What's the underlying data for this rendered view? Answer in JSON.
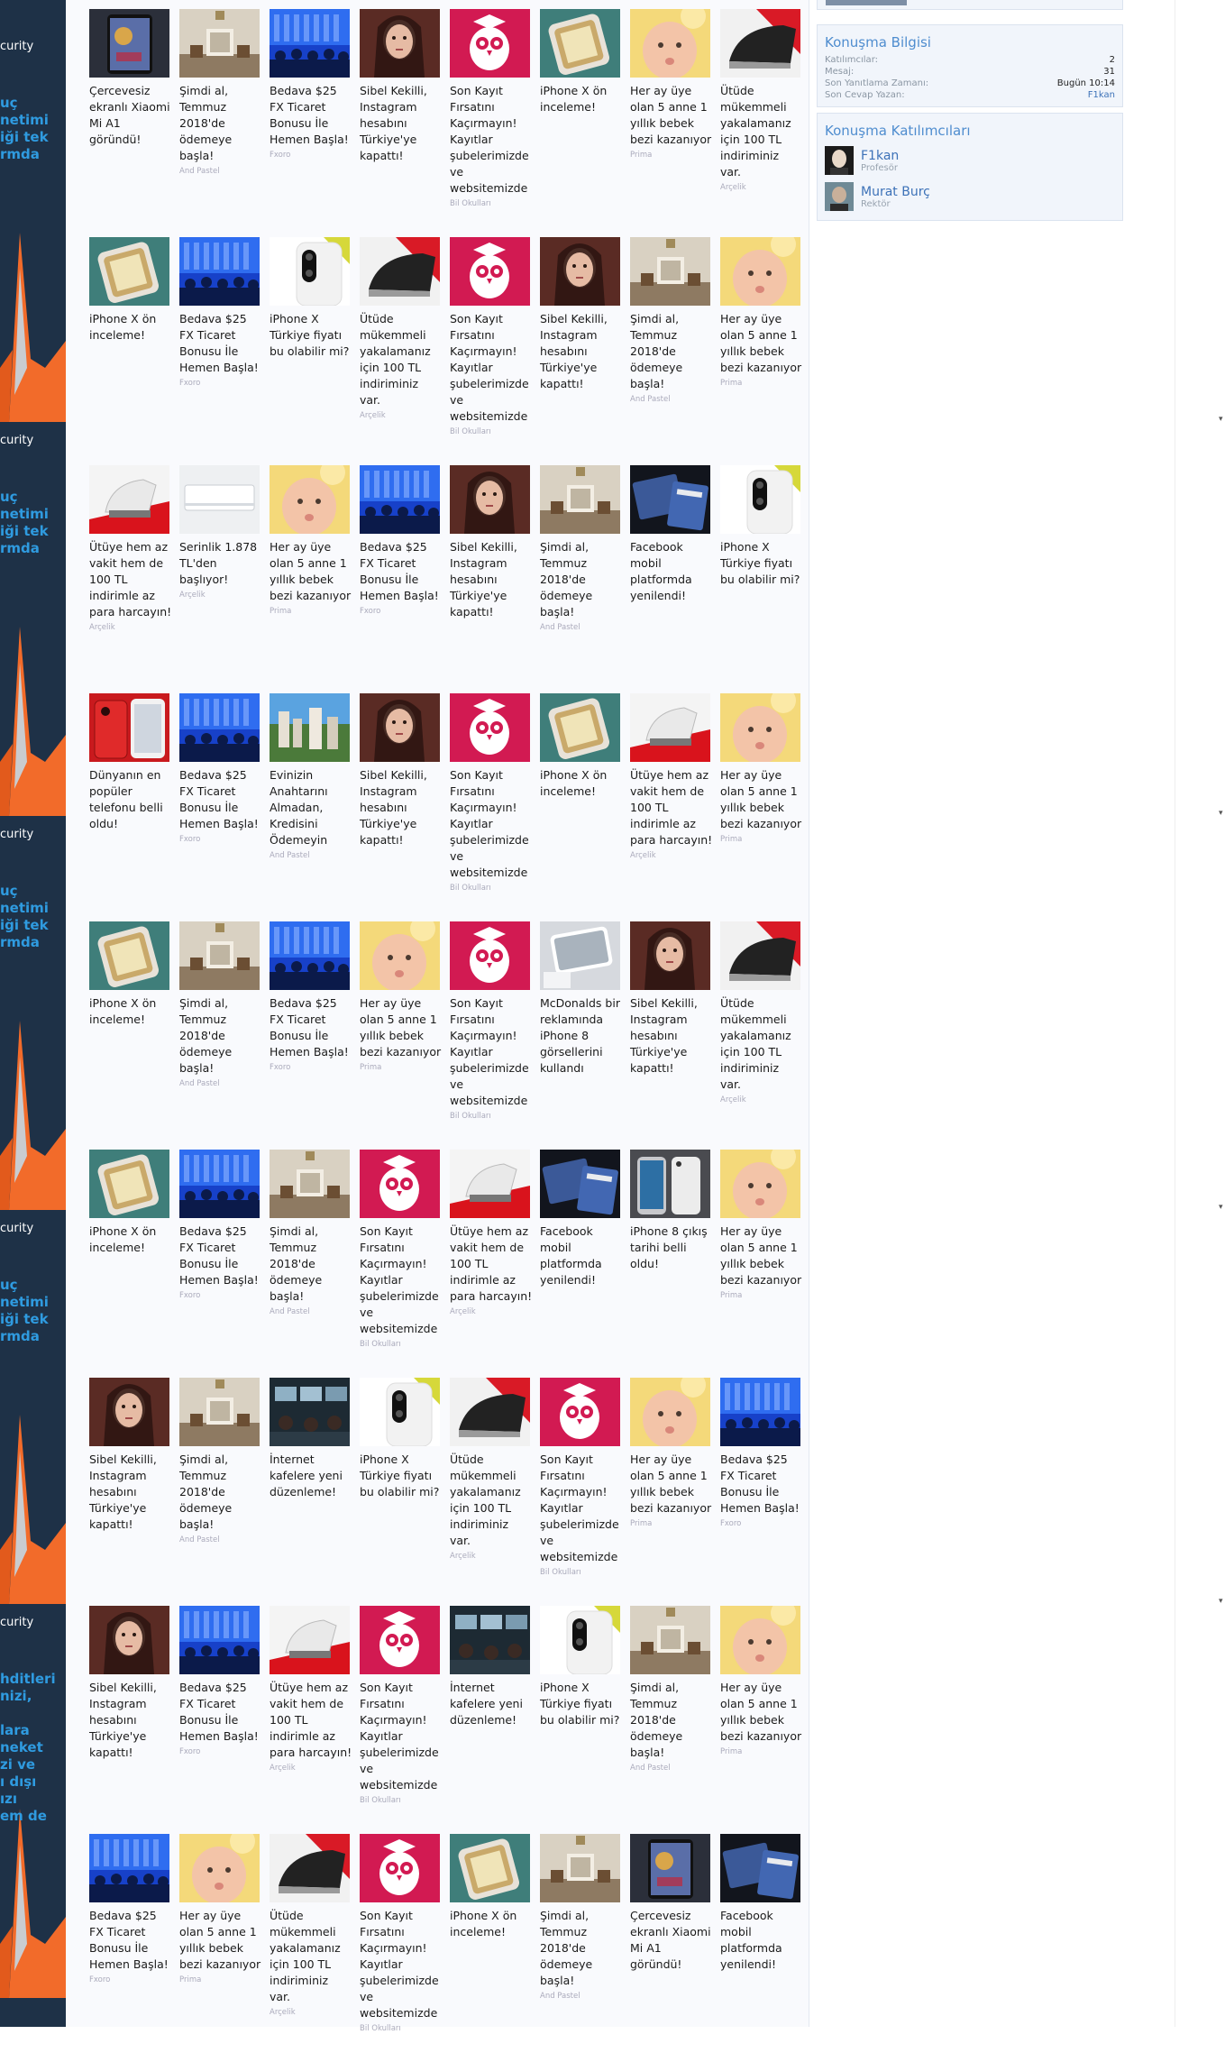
{
  "left_ad": {
    "word": "curity",
    "lines_a": "uç\nnetimi\niği tek\nrmda",
    "lines_b": "hditleri\nnizi,\n\nlara\nneket\nzi ve\nı dışı\nızı\nem de"
  },
  "ads": [
    {
      "title": "Çercevesiz ekranlı Xiaomi Mi A1 göründü!",
      "source": "",
      "img": "phone-dark"
    },
    {
      "title": "Şimdi al, Temmuz 2018'de ödemeye başla!",
      "source": "And Pastel",
      "img": "room"
    },
    {
      "title": "Bedava $25 FX Ticaret Bonusu İle Hemen Başla!",
      "source": "Fxoro",
      "img": "crowd"
    },
    {
      "title": "Sibel Kekilli, Instagram hesabını Türkiye'ye kapattı!",
      "source": "",
      "img": "woman"
    },
    {
      "title": "Son Kayıt Fırsatını Kaçırmayın! Kayıtlar şubelerimizde ve websitemizde",
      "source": "Bil Okulları",
      "img": "owl"
    },
    {
      "title": "iPhone X ön inceleme!",
      "source": "",
      "img": "iphone-green"
    },
    {
      "title": "Her ay üye olan 5 anne 1 yıllık bebek bezi kazanıyor",
      "source": "Prima",
      "img": "baby"
    },
    {
      "title": "Ütüde mükemmeli yakalamanız için 100 TL indiriminiz var.",
      "source": "Arçelik",
      "img": "iron-dark"
    },
    {
      "title": "iPhone X ön inceleme!",
      "source": "",
      "img": "iphone-green"
    },
    {
      "title": "Bedava $25 FX Ticaret Bonusu İle Hemen Başla!",
      "source": "Fxoro",
      "img": "crowd"
    },
    {
      "title": "iPhone X Türkiye fiyatı bu olabilir mi?",
      "source": "",
      "img": "iphone-white"
    },
    {
      "title": "Ütüde mükemmeli yakalamanız için 100 TL indiriminiz var.",
      "source": "Arçelik",
      "img": "iron-dark"
    },
    {
      "title": "Son Kayıt Fırsatını Kaçırmayın! Kayıtlar şubelerimizde ve websitemizde",
      "source": "Bil Okulları",
      "img": "owl"
    },
    {
      "title": "Sibel Kekilli, Instagram hesabını Türkiye'ye kapattı!",
      "source": "",
      "img": "woman"
    },
    {
      "title": "Şimdi al, Temmuz 2018'de ödemeye başla!",
      "source": "And Pastel",
      "img": "room"
    },
    {
      "title": "Her ay üye olan 5 anne 1 yıllık bebek bezi kazanıyor",
      "source": "Prima",
      "img": "baby"
    },
    {
      "title": "Ütüye hem az vakit hem de 100 TL indirimle az para harcayın!",
      "source": "Arçelik",
      "img": "iron-red"
    },
    {
      "title": "Serinlik 1.878 TL'den başlıyor!",
      "source": "Arçelik",
      "img": "ac"
    },
    {
      "title": "Her ay üye olan 5 anne 1 yıllık bebek bezi kazanıyor",
      "source": "Prima",
      "img": "baby"
    },
    {
      "title": "Bedava $25 FX Ticaret Bonusu İle Hemen Başla!",
      "source": "Fxoro",
      "img": "crowd"
    },
    {
      "title": "Sibel Kekilli, Instagram hesabını Türkiye'ye kapattı!",
      "source": "",
      "img": "woman"
    },
    {
      "title": "Şimdi al, Temmuz 2018'de ödemeye başla!",
      "source": "And Pastel",
      "img": "room"
    },
    {
      "title": "Facebook mobil platformda yenilendi!",
      "source": "",
      "img": "facebook"
    },
    {
      "title": "iPhone X Türkiye fiyatı bu olabilir mi?",
      "source": "",
      "img": "iphone-white"
    },
    {
      "title": "Dünyanın en popüler telefonu belli oldu!",
      "source": "",
      "img": "phone-red"
    },
    {
      "title": "Bedava $25 FX Ticaret Bonusu İle Hemen Başla!",
      "source": "Fxoro",
      "img": "crowd"
    },
    {
      "title": "Evinizin Anahtarını Almadan, Kredisini Ödemeyin",
      "source": "And Pastel",
      "img": "city"
    },
    {
      "title": "Sibel Kekilli, Instagram hesabını Türkiye'ye kapattı!",
      "source": "",
      "img": "woman"
    },
    {
      "title": "Son Kayıt Fırsatını Kaçırmayın! Kayıtlar şubelerimizde ve websitemizde",
      "source": "Bil Okulları",
      "img": "owl"
    },
    {
      "title": "iPhone X ön inceleme!",
      "source": "",
      "img": "iphone-green"
    },
    {
      "title": "Ütüye hem az vakit hem de 100 TL indirimle az para harcayın!",
      "source": "Arçelik",
      "img": "iron-red"
    },
    {
      "title": "Her ay üye olan 5 anne 1 yıllık bebek bezi kazanıyor",
      "source": "Prima",
      "img": "baby"
    },
    {
      "title": "iPhone X ön inceleme!",
      "source": "",
      "img": "iphone-green"
    },
    {
      "title": "Şimdi al, Temmuz 2018'de ödemeye başla!",
      "source": "And Pastel",
      "img": "room"
    },
    {
      "title": "Bedava $25 FX Ticaret Bonusu İle Hemen Başla!",
      "source": "Fxoro",
      "img": "crowd"
    },
    {
      "title": "Her ay üye olan 5 anne 1 yıllık bebek bezi kazanıyor",
      "source": "Prima",
      "img": "baby"
    },
    {
      "title": "Son Kayıt Fırsatını Kaçırmayın! Kayıtlar şubelerimizde ve websitemizde",
      "source": "Bil Okulları",
      "img": "owl"
    },
    {
      "title": "McDonalds bir reklamında iPhone 8 görsellerini kullandı",
      "source": "",
      "img": "iphone-grey"
    },
    {
      "title": "Sibel Kekilli, Instagram hesabını Türkiye'ye kapattı!",
      "source": "",
      "img": "woman"
    },
    {
      "title": "Ütüde mükemmeli yakalamanız için 100 TL indiriminiz var.",
      "source": "Arçelik",
      "img": "iron-dark"
    },
    {
      "title": "iPhone X ön inceleme!",
      "source": "",
      "img": "iphone-green"
    },
    {
      "title": "Bedava $25 FX Ticaret Bonusu İle Hemen Başla!",
      "source": "Fxoro",
      "img": "crowd"
    },
    {
      "title": "Şimdi al, Temmuz 2018'de ödemeye başla!",
      "source": "And Pastel",
      "img": "room"
    },
    {
      "title": "Son Kayıt Fırsatını Kaçırmayın! Kayıtlar şubelerimizde ve websitemizde",
      "source": "Bil Okulları",
      "img": "owl"
    },
    {
      "title": "Ütüye hem az vakit hem de 100 TL indirimle az para harcayın!",
      "source": "Arçelik",
      "img": "iron-red"
    },
    {
      "title": "Facebook mobil platformda yenilendi!",
      "source": "",
      "img": "facebook"
    },
    {
      "title": "iPhone 8 çıkış tarihi belli oldu!",
      "source": "",
      "img": "iphone8"
    },
    {
      "title": "Her ay üye olan 5 anne 1 yıllık bebek bezi kazanıyor",
      "source": "Prima",
      "img": "baby"
    },
    {
      "title": "Sibel Kekilli, Instagram hesabını Türkiye'ye kapattı!",
      "source": "",
      "img": "woman"
    },
    {
      "title": "Şimdi al, Temmuz 2018'de ödemeye başla!",
      "source": "And Pastel",
      "img": "room"
    },
    {
      "title": "İnternet kafelere yeni düzenleme!",
      "source": "",
      "img": "cafe"
    },
    {
      "title": "iPhone X Türkiye fiyatı bu olabilir mi?",
      "source": "",
      "img": "iphone-white"
    },
    {
      "title": "Ütüde mükemmeli yakalamanız için 100 TL indiriminiz var.",
      "source": "Arçelik",
      "img": "iron-dark"
    },
    {
      "title": "Son Kayıt Fırsatını Kaçırmayın! Kayıtlar şubelerimizde ve websitemizde",
      "source": "Bil Okulları",
      "img": "owl"
    },
    {
      "title": "Her ay üye olan 5 anne 1 yıllık bebek bezi kazanıyor",
      "source": "Prima",
      "img": "baby"
    },
    {
      "title": "Bedava $25 FX Ticaret Bonusu İle Hemen Başla!",
      "source": "Fxoro",
      "img": "crowd"
    },
    {
      "title": "Sibel Kekilli, Instagram hesabını Türkiye'ye kapattı!",
      "source": "",
      "img": "woman"
    },
    {
      "title": "Bedava $25 FX Ticaret Bonusu İle Hemen Başla!",
      "source": "Fxoro",
      "img": "crowd"
    },
    {
      "title": "Ütüye hem az vakit hem de 100 TL indirimle az para harcayın!",
      "source": "Arçelik",
      "img": "iron-red"
    },
    {
      "title": "Son Kayıt Fırsatını Kaçırmayın! Kayıtlar şubelerimizde ve websitemizde",
      "source": "Bil Okulları",
      "img": "owl"
    },
    {
      "title": "İnternet kafelere yeni düzenleme!",
      "source": "",
      "img": "cafe"
    },
    {
      "title": "iPhone X Türkiye fiyatı bu olabilir mi?",
      "source": "",
      "img": "iphone-white"
    },
    {
      "title": "Şimdi al, Temmuz 2018'de ödemeye başla!",
      "source": "And Pastel",
      "img": "room"
    },
    {
      "title": "Her ay üye olan 5 anne 1 yıllık bebek bezi kazanıyor",
      "source": "Prima",
      "img": "baby"
    },
    {
      "title": "Bedava $25 FX Ticaret Bonusu İle Hemen Başla!",
      "source": "Fxoro",
      "img": "crowd"
    },
    {
      "title": "Her ay üye olan 5 anne 1 yıllık bebek bezi kazanıyor",
      "source": "Prima",
      "img": "baby"
    },
    {
      "title": "Ütüde mükemmeli yakalamanız için 100 TL indiriminiz var.",
      "source": "Arçelik",
      "img": "iron-dark"
    },
    {
      "title": "Son Kayıt Fırsatını Kaçırmayın! Kayıtlar şubelerimizde ve websitemizde",
      "source": "Bil Okulları",
      "img": "owl"
    },
    {
      "title": "iPhone X ön inceleme!",
      "source": "",
      "img": "iphone-green"
    },
    {
      "title": "Şimdi al, Temmuz 2018'de ödemeye başla!",
      "source": "And Pastel",
      "img": "room"
    },
    {
      "title": "Çercevesiz ekranlı Xiaomi Mi A1 göründü!",
      "source": "",
      "img": "phone-dark"
    },
    {
      "title": "Facebook mobil platformda yenilendi!",
      "source": "",
      "img": "facebook"
    }
  ],
  "sidebar": {
    "thread_info": {
      "title": "Konuşma Bilgisi",
      "rows": [
        {
          "label": "Katılımcılar:",
          "value": "2"
        },
        {
          "label": "Mesaj:",
          "value": "31"
        },
        {
          "label": "Son Yanıtlama Zamanı:",
          "value": "Bugün 10:14"
        },
        {
          "label": "Son Cevap Yazan:",
          "value": "F1kan"
        }
      ]
    },
    "participants": {
      "title": "Konuşma Katılımcıları",
      "items": [
        {
          "name": "F1kan",
          "role": "Profesör"
        },
        {
          "name": "Murat Burç",
          "role": "Rektör"
        }
      ]
    }
  },
  "colors": {
    "page_bg": "#f9fafd",
    "ad_bg": "#1e3147",
    "ad_accent": "#f26b2a",
    "ad_text": "#2f9be0",
    "link": "#3d72b8",
    "heading": "#4f8dcf"
  }
}
